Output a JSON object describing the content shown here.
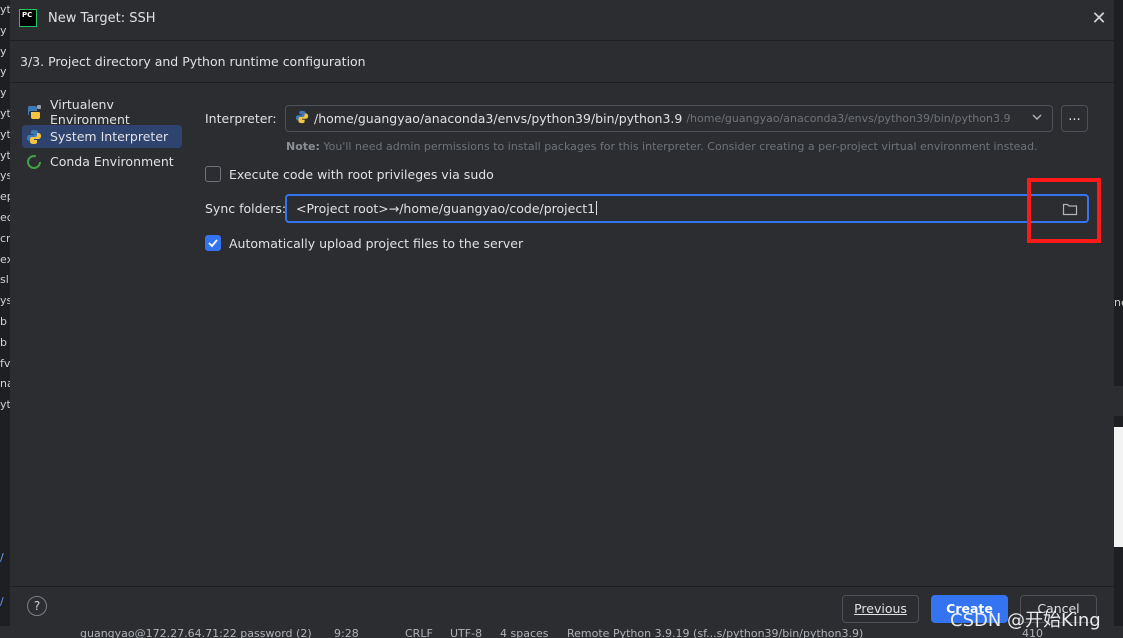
{
  "background": {
    "left_fragments": [
      "yt",
      "y",
      "y",
      "y",
      "y",
      "yt",
      "yt",
      "yt",
      "ys",
      "ep",
      "ec",
      "cr",
      "ex",
      "sl",
      "ys",
      "b",
      "b",
      "fv",
      "na",
      "yt"
    ],
    "left_links": [
      "/",
      "/"
    ],
    "right_fragment": "ne"
  },
  "dialog": {
    "logo_text": "PC",
    "title": "New Target: SSH",
    "step": "3/3. Project directory and Python runtime configuration"
  },
  "sidebar": {
    "items": [
      {
        "label": "Virtualenv Environment",
        "icon": "virtualenv-icon",
        "selected": false
      },
      {
        "label": "System Interpreter",
        "icon": "python-icon",
        "selected": true
      },
      {
        "label": "Conda Environment",
        "icon": "conda-icon",
        "selected": false
      }
    ]
  },
  "form": {
    "interpreter_label": "Interpreter:",
    "interpreter_value": "/home/guangyao/anaconda3/envs/python39/bin/python3.9",
    "interpreter_path_hint": "/home/guangyao/anaconda3/envs/python39/bin/python3.9",
    "browse_label": "...",
    "note_prefix": "Note:",
    "note_text": "You'll need admin permissions to install packages for this interpreter. Consider creating a per-project virtual environment instead.",
    "sudo_label": "Execute code with root privileges via sudo",
    "sudo_checked": false,
    "sync_label": "Sync folders:",
    "sync_value": "<Project root>→/home/guangyao/code/project1",
    "auto_upload_label": "Automatically upload project files to the server",
    "auto_upload_checked": true
  },
  "buttons": {
    "help": "?",
    "previous": "Previous",
    "create": "Create",
    "cancel": "Cancel"
  },
  "statusbar": {
    "connection": "guangyao@172.27.64.71:22 password (2)",
    "position": "9:28",
    "line_sep": "CRLF",
    "encoding": "UTF-8",
    "indent": "4 spaces",
    "interpreter": "Remote Python 3.9.19 (sf...s/python39/bin/python3.9)",
    "extra": "410"
  },
  "watermark": "CSDN @开始King",
  "colors": {
    "accent": "#3574f0",
    "highlight_box": "#ff1a1a",
    "selected_row": "#2e436e"
  }
}
